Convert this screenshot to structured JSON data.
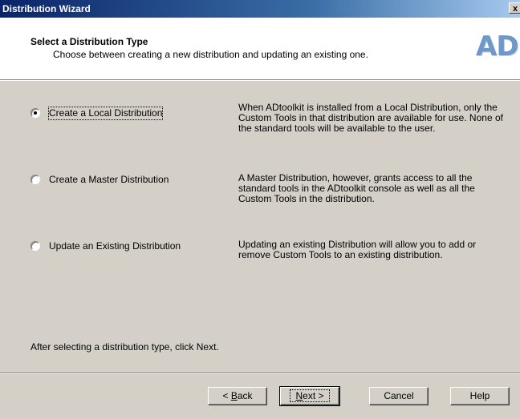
{
  "window": {
    "title": "Distribution Wizard",
    "close_glyph": "x"
  },
  "header": {
    "title": "Select a Distribution Type",
    "subtitle": "Choose between creating a new distribution and updating an existing one.",
    "logo_text": "AD"
  },
  "options": [
    {
      "label": "Create a Local Distribution",
      "selected": true,
      "description": "When ADtoolkit is installed from a Local Distribution, only the Custom Tools in that distribution are available for use.  None of the standard tools will be available to the user."
    },
    {
      "label": "Create a Master Distribution",
      "selected": false,
      "description": "A Master Distribution, however, grants access to all the standard tools in the ADtoolkit console as well as all the Custom Tools in the distribution."
    },
    {
      "label": "Update an Existing Distribution",
      "selected": false,
      "description": "Updating an existing Distribution will allow you to add or remove Custom Tools to an existing distribution."
    }
  ],
  "footer": {
    "instruction": "After selecting a distribution type, click Next."
  },
  "buttons": {
    "back": {
      "prefix": "< ",
      "mnemonic": "B",
      "rest": "ack"
    },
    "next": {
      "mnemonic": "N",
      "rest": "ext >"
    },
    "cancel": "Cancel",
    "help": "Help"
  }
}
